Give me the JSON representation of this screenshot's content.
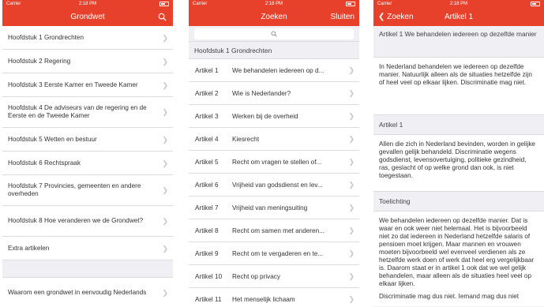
{
  "status": {
    "carrier": "Carrier",
    "time": "2:18 PM"
  },
  "screen1": {
    "title": "Grondwet",
    "items": [
      "Hoofdstuk 1 Grondrechten",
      "Hoofdstuk 2 Regering",
      "Hoofdstuk 3 Eerste Kamer en Tweede Kamer",
      "Hoofdstuk 4 De adviseurs van de regering en de Eerste en de Tweede Kamer",
      "Hoofdstuk 5 Wetten en bestuur",
      "Hoofdstuk 6 Rechtspraak",
      "Hoofdstuk 7 Provincies, gemeenten en andere overheden",
      "Hoofdstuk 8 Hoe veranderen we de Grondwet?",
      "Extra artikelen"
    ],
    "footer_item": "Waarom een grondwet in eenvoudig Nederlands"
  },
  "screen2": {
    "title": "Zoeken",
    "close_label": "Sluiten",
    "section": "Hoofdstuk 1 Grondrechten",
    "articles": [
      {
        "num": "Artikel 1",
        "desc": "We behandelen iedereen op d..."
      },
      {
        "num": "Artikel 2",
        "desc": "Wie is Nederlander?"
      },
      {
        "num": "Artikel 3",
        "desc": "Werken bij de overheid"
      },
      {
        "num": "Artikel 4",
        "desc": "Kiesrecht"
      },
      {
        "num": "Artikel 5",
        "desc": "Recht om vragen te stellen of..."
      },
      {
        "num": "Artikel 6",
        "desc": "Vrijheid van godsdienst en lev..."
      },
      {
        "num": "Artikel 7",
        "desc": "Vrijheid van meningsuiting"
      },
      {
        "num": "Artikel 8",
        "desc": "Recht om samen met anderen..."
      },
      {
        "num": "Artikel 9",
        "desc": "Recht om te vergaderen en te..."
      },
      {
        "num": "Artikel 10",
        "desc": "Recht op privacy"
      },
      {
        "num": "Artikel 11",
        "desc": "Het menselijk lichaam"
      }
    ]
  },
  "screen3": {
    "back_label": "Zoeken",
    "title": "Artikel 1",
    "header1": "Artikel 1 We behandelen iedereen op dezelfde manier",
    "body1": "In Nederland behandelen we iedereen op dezelfde manier. Natuurlijk alleen als de situaties hetzelfde zijn of heel veel op elkaar lijken. Discriminatie mag niet.",
    "header2": "Artikel 1",
    "body2": "Allen die zich in Nederland bevinden, worden in gelijke gevallen gelijk behandeld. Discriminatie wegens godsdienst, levensovertuiging, politieke gezindheid, ras, geslacht of op welke grond dan ook, is niet toegestaan.",
    "header3": "Toelichting",
    "body3": "We behandelen iedereen op dezelfde manier. Dat is waar en ook weer niet helemaal. Het is bijvoorbeeld niet zo dat iedereen in Nederland hetzelfde salaris of pensioen moet krijgen. Maar mannen en vrouwen moeten bijvoorbeeld wel evenveel verdienen als ze hetzelfde werk doen of werk dat heel erg vergelijkbaar is. Daarom staat er in artikel 1 ook dat we wel gelijk behandelen, maar alleen als de situaties heel veel op elkaar lijken.",
    "body4": "Discriminatie mag dus niet. Iemand mag dus niet"
  },
  "colors": {
    "accent": "#e8412b",
    "background": "#efeff4"
  }
}
